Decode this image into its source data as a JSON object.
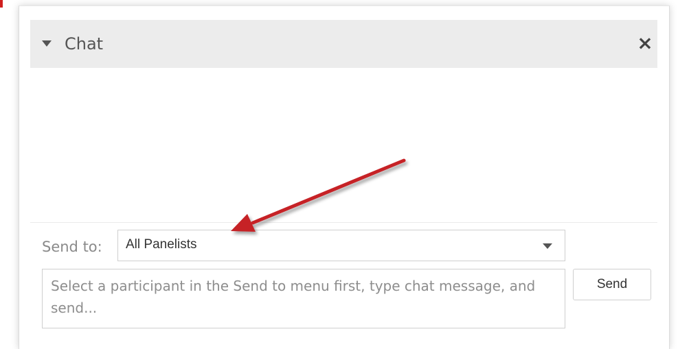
{
  "chat": {
    "title": "Chat",
    "close_symbol": "×",
    "send_to_label": "Send to:",
    "send_to_selected": "All Panelists",
    "message_placeholder": "Select a participant in the Send to menu first, type chat message, and send...",
    "send_label": "Send"
  },
  "annotation": {
    "arrow_color": "#c62026"
  },
  "icons": {
    "collapse": "caret-down-icon",
    "close": "close-icon",
    "dropdown": "chevron-down-icon"
  }
}
